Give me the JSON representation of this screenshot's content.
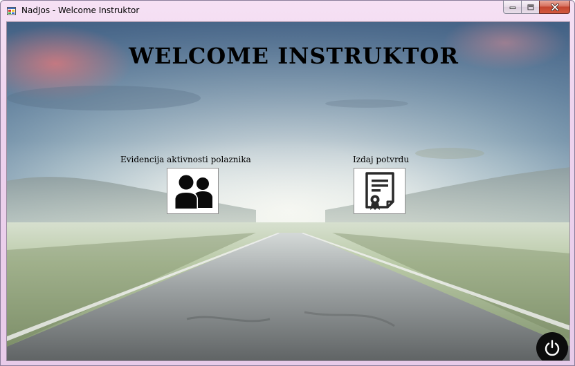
{
  "window": {
    "title": "NadJos - Welcome Instruktor",
    "controls": {
      "minimize_icon": "minimize-icon",
      "maximize_icon": "maximize-icon",
      "close_icon": "close-icon"
    }
  },
  "main": {
    "heading": "WELCOME INSTRUKTOR",
    "actions": [
      {
        "label": "Evidencija aktivnosti polaznika",
        "icon": "users-icon"
      },
      {
        "label": "Izdaj potvrdu",
        "icon": "certificate-icon"
      }
    ],
    "power_icon": "power-icon"
  },
  "colors": {
    "titlebar": "#eed3ee",
    "close_button": "#c2452f",
    "power_button": "#0c0c0c",
    "text": "#000000"
  }
}
